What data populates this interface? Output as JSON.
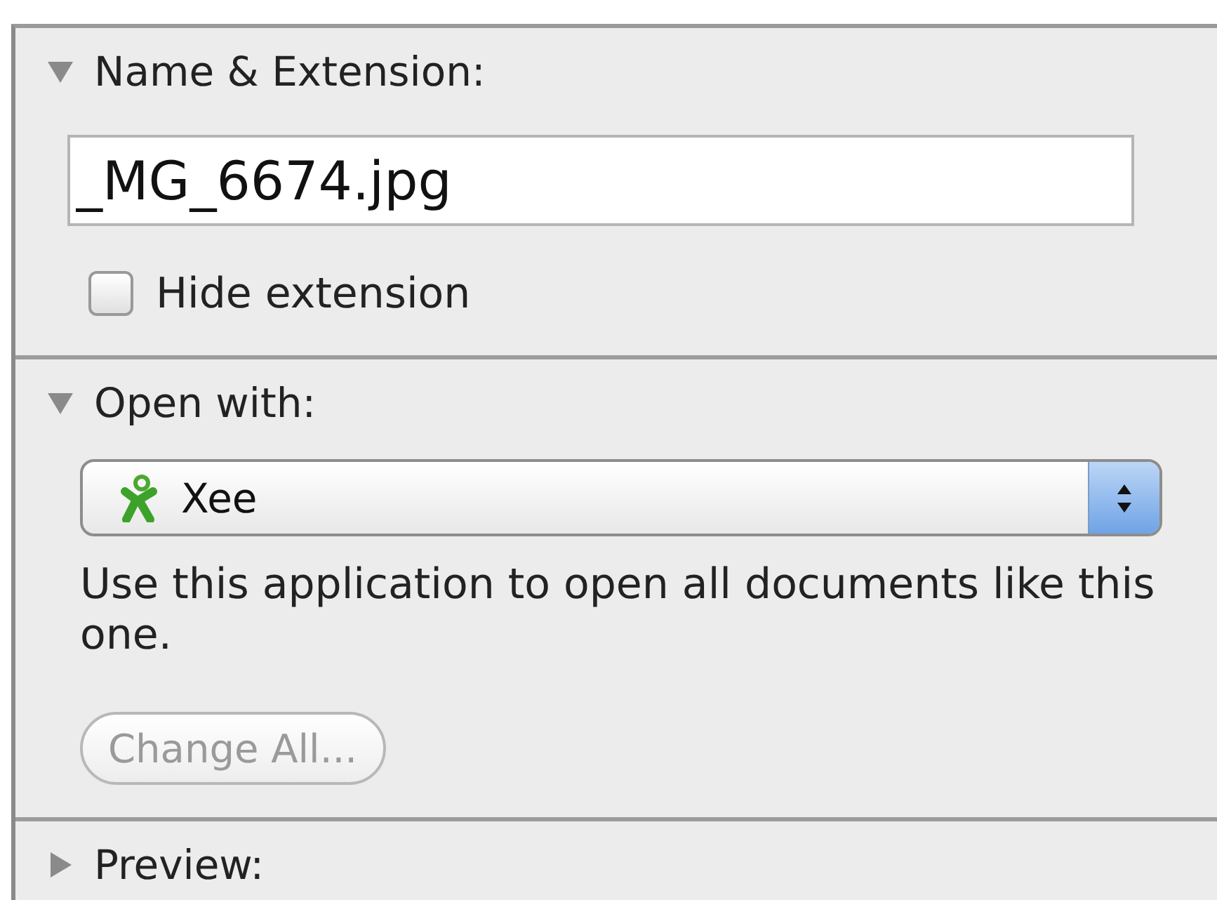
{
  "sections": [
    {
      "kind": "name",
      "title": "Name & Extension:",
      "expanded": true,
      "name_value": "_MG_6674.jpg",
      "hide_extension": {
        "label": "Hide extension",
        "checked": false
      }
    },
    {
      "kind": "open_with",
      "title": "Open with:",
      "expanded": true,
      "app": "Xee",
      "description": "Use this application to open all documents like this one.",
      "button": {
        "label": "Change All...",
        "disabled": true
      }
    },
    {
      "title": "Preview:",
      "expanded": false
    }
  ]
}
